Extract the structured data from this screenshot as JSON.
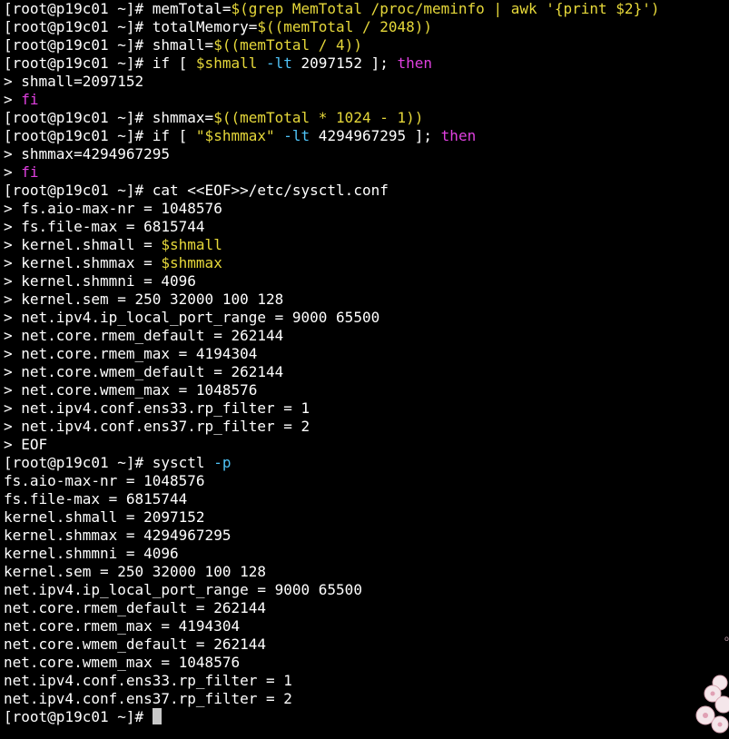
{
  "terminal": {
    "background": "#000000",
    "colors": {
      "default": "#ffffff",
      "string": "#e6d83a",
      "keyword": "#e040e0",
      "option": "#4fc3f7",
      "cursor": "#c8c8c8"
    },
    "lines": [
      [
        {
          "t": "[root@p19c01 ~]# memTotal=",
          "c": "w"
        },
        {
          "t": "$(grep MemTotal /proc/meminfo | awk '{print $2}')",
          "c": "y"
        }
      ],
      [
        {
          "t": "[root@p19c01 ~]# totalMemory=",
          "c": "w"
        },
        {
          "t": "$((memTotal / 2048))",
          "c": "y"
        }
      ],
      [
        {
          "t": "[root@p19c01 ~]# shmall=",
          "c": "w"
        },
        {
          "t": "$((memTotal / 4))",
          "c": "y"
        }
      ],
      [
        {
          "t": "[root@p19c01 ~]# if [ ",
          "c": "w"
        },
        {
          "t": "$shmall",
          "c": "y"
        },
        {
          "t": " ",
          "c": "w"
        },
        {
          "t": "-lt",
          "c": "c"
        },
        {
          "t": " 2097152 ]; ",
          "c": "w"
        },
        {
          "t": "then",
          "c": "m"
        }
      ],
      [
        {
          "t": "> shmall=2097152",
          "c": "w"
        }
      ],
      [
        {
          "t": "> ",
          "c": "w"
        },
        {
          "t": "fi",
          "c": "m"
        }
      ],
      [
        {
          "t": "[root@p19c01 ~]# shmmax=",
          "c": "w"
        },
        {
          "t": "$((memTotal * 1024 - 1))",
          "c": "y"
        }
      ],
      [
        {
          "t": "[root@p19c01 ~]# if [ ",
          "c": "w"
        },
        {
          "t": "\"$shmmax\"",
          "c": "y"
        },
        {
          "t": " ",
          "c": "w"
        },
        {
          "t": "-lt",
          "c": "c"
        },
        {
          "t": " 4294967295 ]; ",
          "c": "w"
        },
        {
          "t": "then",
          "c": "m"
        }
      ],
      [
        {
          "t": "> shmmax=4294967295",
          "c": "w"
        }
      ],
      [
        {
          "t": "> ",
          "c": "w"
        },
        {
          "t": "fi",
          "c": "m"
        }
      ],
      [
        {
          "t": "[root@p19c01 ~]# cat <<EOF>>/etc/sysctl.conf",
          "c": "w"
        }
      ],
      [
        {
          "t": "> fs.aio-max-nr = 1048576",
          "c": "w"
        }
      ],
      [
        {
          "t": "> fs.file-max = 6815744",
          "c": "w"
        }
      ],
      [
        {
          "t": "> kernel.shmall = ",
          "c": "w"
        },
        {
          "t": "$shmall",
          "c": "y"
        }
      ],
      [
        {
          "t": "> kernel.shmmax = ",
          "c": "w"
        },
        {
          "t": "$shmmax",
          "c": "y"
        }
      ],
      [
        {
          "t": "> kernel.shmmni = 4096",
          "c": "w"
        }
      ],
      [
        {
          "t": "> kernel.sem = 250 32000 100 128",
          "c": "w"
        }
      ],
      [
        {
          "t": "> net.ipv4.ip_local_port_range = 9000 65500",
          "c": "w"
        }
      ],
      [
        {
          "t": "> net.core.rmem_default = 262144",
          "c": "w"
        }
      ],
      [
        {
          "t": "> net.core.rmem_max = 4194304",
          "c": "w"
        }
      ],
      [
        {
          "t": "> net.core.wmem_default = 262144",
          "c": "w"
        }
      ],
      [
        {
          "t": "> net.core.wmem_max = 1048576",
          "c": "w"
        }
      ],
      [
        {
          "t": "> net.ipv4.conf.ens33.rp_filter = 1",
          "c": "w"
        }
      ],
      [
        {
          "t": "> net.ipv4.conf.ens37.rp_filter = 2",
          "c": "w"
        }
      ],
      [
        {
          "t": "> EOF",
          "c": "w"
        }
      ],
      [
        {
          "t": "[root@p19c01 ~]# sysctl ",
          "c": "w"
        },
        {
          "t": "-p",
          "c": "c"
        }
      ],
      [
        {
          "t": "fs.aio-max-nr = 1048576",
          "c": "w"
        }
      ],
      [
        {
          "t": "fs.file-max = 6815744",
          "c": "w"
        }
      ],
      [
        {
          "t": "kernel.shmall = 2097152",
          "c": "w"
        }
      ],
      [
        {
          "t": "kernel.shmmax = 4294967295",
          "c": "w"
        }
      ],
      [
        {
          "t": "kernel.shmmni = 4096",
          "c": "w"
        }
      ],
      [
        {
          "t": "kernel.sem = 250 32000 100 128",
          "c": "w"
        }
      ],
      [
        {
          "t": "net.ipv4.ip_local_port_range = 9000 65500",
          "c": "w"
        }
      ],
      [
        {
          "t": "net.core.rmem_default = 262144",
          "c": "w"
        }
      ],
      [
        {
          "t": "net.core.rmem_max = 4194304",
          "c": "w"
        }
      ],
      [
        {
          "t": "net.core.wmem_default = 262144",
          "c": "w"
        }
      ],
      [
        {
          "t": "net.core.wmem_max = 1048576",
          "c": "w"
        }
      ],
      [
        {
          "t": "net.ipv4.conf.ens33.rp_filter = 1",
          "c": "w"
        }
      ],
      [
        {
          "t": "net.ipv4.conf.ens37.rp_filter = 2",
          "c": "w"
        }
      ],
      [
        {
          "t": "[root@p19c01 ~]# ",
          "c": "w"
        }
      ]
    ],
    "cursor_line": 39
  }
}
